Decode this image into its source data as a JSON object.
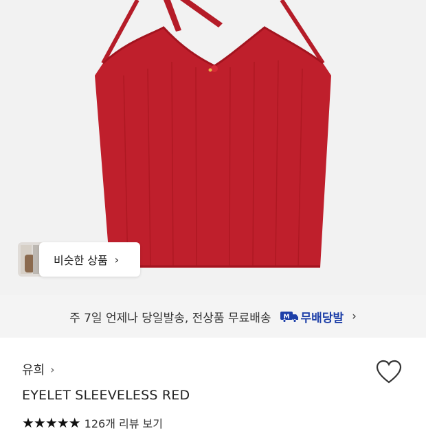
{
  "similar": {
    "label": "비슷한 상품",
    "chevron": "›"
  },
  "shipping": {
    "text": "주 7일 언제나 당일발송, 전상품 무료배송",
    "logo_text": "무배당발",
    "logo_icon": "delivery-truck-m-icon",
    "chevron": "›"
  },
  "product": {
    "brand": "유희",
    "brand_chevron": "›",
    "title": "EYELET SLEEVELESS RED",
    "stars": "★★★★★",
    "rating": 5,
    "review_text": "126개 리뷰 보기",
    "color": "#bf1f2c"
  },
  "colors": {
    "background": "#f2f2f2",
    "banner": "#f4f4f4",
    "brand_blue": "#1d3fa8"
  }
}
